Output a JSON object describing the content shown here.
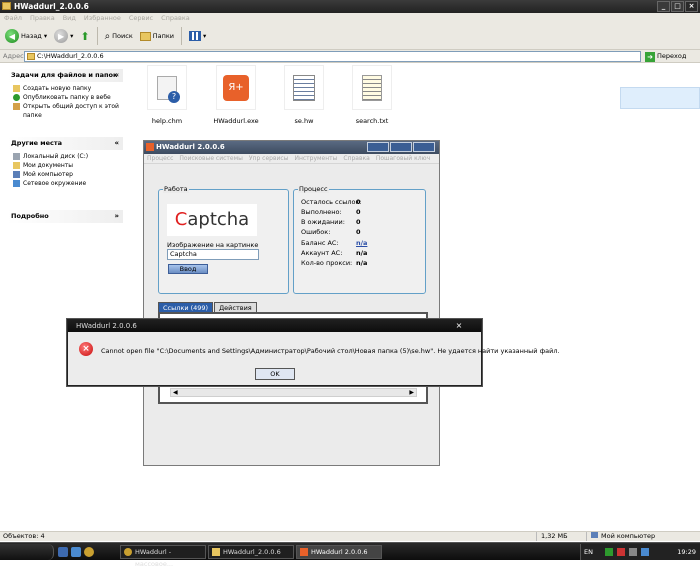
{
  "explorer": {
    "title": "HWaddurl_2.0.0.6",
    "menu": [
      "Файл",
      "Правка",
      "Вид",
      "Избранное",
      "Сервис",
      "Справка"
    ],
    "toolbar": {
      "back": "Назад",
      "search": "Поиск",
      "folders": "Папки"
    },
    "address_label": "Адрес:",
    "address": "C:\\HWaddurl_2.0.0.6",
    "go": "Переход"
  },
  "tasks": {
    "header": "Задачи для файлов и папок",
    "items": [
      "Создать новую папку",
      "Опубликовать папку в вебе",
      "Открыть общий доступ к этой папке"
    ]
  },
  "places": {
    "header": "Другие места",
    "items": [
      "Локальный диск (C:)",
      "Мои документы",
      "Мой компьютер",
      "Сетевое окружение"
    ]
  },
  "details": {
    "header": "Подробно"
  },
  "files": [
    {
      "name": "help.chm",
      "icon": "help-file-icon"
    },
    {
      "name": "HWaddurl.exe",
      "icon": "app-exe-icon",
      "badge": "Я+"
    },
    {
      "name": "se.hw",
      "icon": "hw-file-icon"
    },
    {
      "name": "search.txt",
      "icon": "text-file-icon"
    }
  ],
  "app": {
    "title": "HWaddurl 2.0.0.6",
    "menu": [
      "Процесс",
      "Поисковые системы",
      "Упр сервисы",
      "Инструменты",
      "Справка",
      "Пошаговый ключ"
    ],
    "work_group": "Работа",
    "captcha_text": "Captcha",
    "captcha_label": "Изображение на картинке",
    "captcha_input": "Captcha",
    "submit": "Ввод",
    "process_group": "Процесс",
    "stats": [
      {
        "label": "Осталось ссылок:",
        "value": "0"
      },
      {
        "label": "Выполнено:",
        "value": "0"
      },
      {
        "label": "В ожидании:",
        "value": "0"
      },
      {
        "label": "Ошибок:",
        "value": "0"
      },
      {
        "label": "Баланс АС:",
        "value": "n/a"
      },
      {
        "label": "Аккаунт АС:",
        "value": "n/a"
      },
      {
        "label": "Кол-во прокси:",
        "value": "n/a"
      }
    ],
    "tabs": [
      "Ссылки (499)",
      "Действия"
    ]
  },
  "dialog": {
    "title": "HWaddurl 2.0.0.6",
    "close": "×",
    "message": "Cannot open file \"C:\\Documents and Settings\\Администратор\\Рабочий стол\\Новая папка (5)\\se.hw\". Не удается найти указанный файл.",
    "ok": "OK"
  },
  "statusbar": {
    "objects": "Объектов: 4",
    "size": "1,32 МБ",
    "location": "Мой компьютер"
  },
  "taskbar": {
    "items": [
      "HWaddurl - массовое...",
      "HWaddurl_2.0.0.6",
      "HWaddurl 2.0.0.6"
    ],
    "lang": "EN",
    "clock": "19:29"
  }
}
